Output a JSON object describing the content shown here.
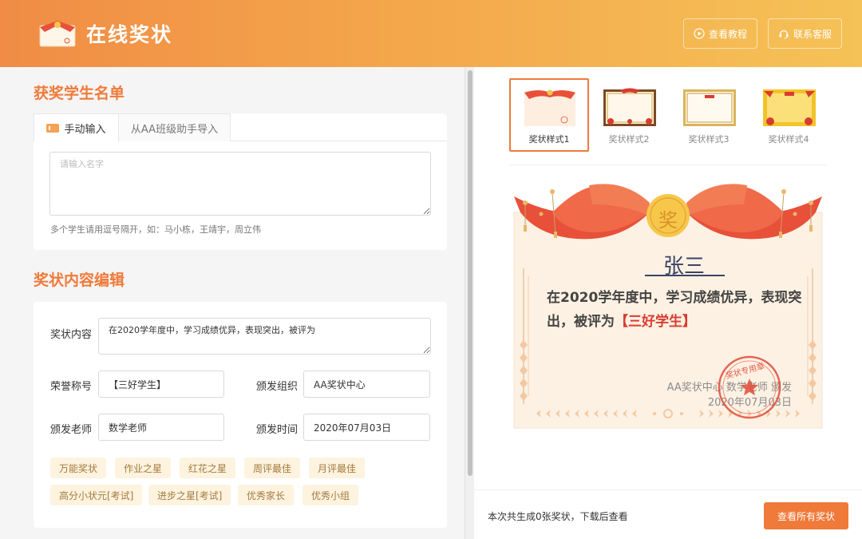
{
  "header": {
    "title": "在线奖状",
    "tutorial_label": "查看教程",
    "service_label": "联系客服"
  },
  "students": {
    "section_title": "获奖学生名单",
    "tab_manual": "手动输入",
    "tab_import": "从AA班级助手导入",
    "name_placeholder": "请输入名字",
    "name_value": "",
    "hint": "多个学生请用逗号隔开，如：马小栋，王靖宇，周立伟"
  },
  "content_edit": {
    "section_title": "奖状内容编辑",
    "content_label": "奖状内容",
    "content_value": "在2020学年度中，学习成绩优异，表现突出，被评为",
    "honor_label": "荣誉称号",
    "honor_value": "【三好学生】",
    "org_label": "颁发组织",
    "org_value": "AA奖状中心",
    "teacher_label": "颁发老师",
    "teacher_value": "数学老师",
    "date_label": "颁发时间",
    "date_value": "2020年07月03日",
    "tags": [
      "万能奖状",
      "作业之星",
      "红花之星",
      "周评最佳",
      "月评最佳",
      "高分小状元[考试]",
      "进步之星[考试]",
      "优秀家长",
      "优秀小组"
    ]
  },
  "styles": {
    "items": [
      "奖状样式1",
      "奖状样式2",
      "奖状样式3",
      "奖状样式4"
    ],
    "selected": 0
  },
  "certificate": {
    "badge_char": "奖",
    "student_name": "张三",
    "text_main": "在2020学年度中，学习成绩优异，表现突出，被评为",
    "text_honor": "【三好学生】",
    "issuer": "AA奖状中心 数学老师 颁发",
    "date": "2020年07月03日",
    "seal_text": "奖状专用章"
  },
  "footer": {
    "gen_info": "本次共生成0张奖状，下载后查看",
    "view_all_label": "查看所有奖状"
  },
  "colors": {
    "accent": "#f07a3a",
    "header_start": "#f08c45",
    "header_end": "#f5c257",
    "ribbon_red": "#e8503a",
    "badge_gold": "#f7c74a",
    "tag_bg": "#fdf3df"
  }
}
